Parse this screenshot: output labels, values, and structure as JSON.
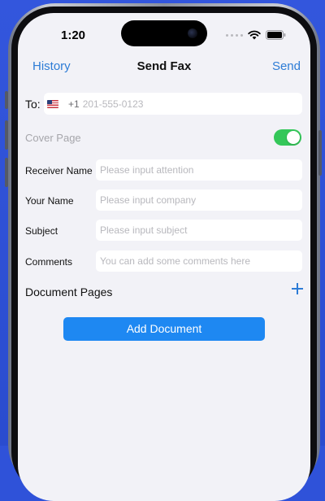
{
  "status_bar": {
    "time": "1:20"
  },
  "nav": {
    "left": "History",
    "title": "Send Fax",
    "right": "Send"
  },
  "to_row": {
    "label": "To:",
    "country_code": "+1",
    "placeholder": "201-555-0123"
  },
  "cover_page": {
    "label": "Cover Page",
    "enabled": true
  },
  "fields": [
    {
      "label": "Receiver Name",
      "placeholder": "Please input attention"
    },
    {
      "label": "Your Name",
      "placeholder": "Please input company"
    },
    {
      "label": "Subject",
      "placeholder": "Please input subject"
    },
    {
      "label": "Comments",
      "placeholder": "You can add some comments here"
    }
  ],
  "documents": {
    "label": "Document Pages",
    "add_button": "Add Document"
  },
  "colors": {
    "accent": "#2d7cd6",
    "toggle_on": "#34c759",
    "button": "#1e88f2",
    "background": "#2f52d9"
  },
  "icons": [
    "wifi-icon",
    "battery-icon",
    "flag-us-icon",
    "plus-icon"
  ]
}
